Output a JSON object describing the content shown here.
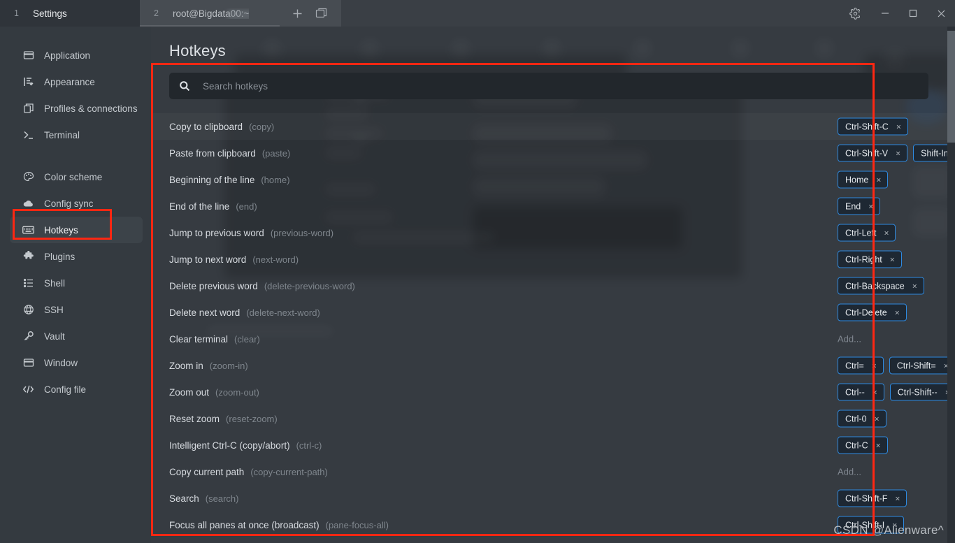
{
  "window": {
    "tabs": [
      {
        "index": "1",
        "label": "Settings",
        "active": false
      },
      {
        "index": "2",
        "label": "root@Bigdata00:~",
        "active": true
      }
    ],
    "new_tab_icon": "plus-icon",
    "split_icon": "split-pane-icon",
    "controls": {
      "settings": "gear-icon",
      "minimize": "minimize-icon",
      "maximize": "maximize-icon",
      "close": "close-icon"
    }
  },
  "sidebar": {
    "groups": [
      {
        "items": [
          {
            "label": "Application",
            "icon": "window-icon"
          },
          {
            "label": "Appearance",
            "icon": "paint-brush-icon"
          },
          {
            "label": "Profiles & connections",
            "icon": "copy-icon"
          },
          {
            "label": "Terminal",
            "icon": "terminal-prompt-icon"
          }
        ]
      },
      {
        "items": [
          {
            "label": "Color scheme",
            "icon": "palette-icon"
          },
          {
            "label": "Config sync",
            "icon": "cloud-icon"
          },
          {
            "label": "Hotkeys",
            "icon": "keyboard-icon",
            "active": true
          },
          {
            "label": "Plugins",
            "icon": "puzzle-piece-icon"
          },
          {
            "label": "Shell",
            "icon": "list-icon"
          },
          {
            "label": "SSH",
            "icon": "globe-icon"
          },
          {
            "label": "Vault",
            "icon": "key-icon"
          },
          {
            "label": "Window",
            "icon": "window-icon"
          },
          {
            "label": "Config file",
            "icon": "code-icon"
          }
        ]
      }
    ]
  },
  "main": {
    "title": "Hotkeys",
    "search": {
      "placeholder": "Search hotkeys",
      "value": "",
      "icon": "search-icon"
    },
    "add_label": "Add...",
    "rows": [
      {
        "label": "Copy to clipboard",
        "id": "(copy)",
        "hover": true,
        "chips": [
          "Ctrl-Shift-C"
        ]
      },
      {
        "label": "Paste from clipboard",
        "id": "(paste)",
        "chips": [
          "Ctrl-Shift-V",
          "Shift-Insert"
        ]
      },
      {
        "label": "Beginning of the line",
        "id": "(home)",
        "chips": [
          "Home"
        ]
      },
      {
        "label": "End of the line",
        "id": "(end)",
        "chips": [
          "End"
        ]
      },
      {
        "label": "Jump to previous word",
        "id": "(previous-word)",
        "chips": [
          "Ctrl-Left"
        ]
      },
      {
        "label": "Jump to next word",
        "id": "(next-word)",
        "chips": [
          "Ctrl-Right"
        ]
      },
      {
        "label": "Delete previous word",
        "id": "(delete-previous-word)",
        "chips": [
          "Ctrl-Backspace"
        ]
      },
      {
        "label": "Delete next word",
        "id": "(delete-next-word)",
        "chips": [
          "Ctrl-Delete"
        ]
      },
      {
        "label": "Clear terminal",
        "id": "(clear)",
        "chips": [],
        "add": true
      },
      {
        "label": "Zoom in",
        "id": "(zoom-in)",
        "chips": [
          "Ctrl=",
          "Ctrl-Shift="
        ]
      },
      {
        "label": "Zoom out",
        "id": "(zoom-out)",
        "chips": [
          "Ctrl--",
          "Ctrl-Shift--"
        ]
      },
      {
        "label": "Reset zoom",
        "id": "(reset-zoom)",
        "chips": [
          "Ctrl-0"
        ]
      },
      {
        "label": "Intelligent Ctrl-C (copy/abort)",
        "id": "(ctrl-c)",
        "chips": [
          "Ctrl-C"
        ]
      },
      {
        "label": "Copy current path",
        "id": "(copy-current-path)",
        "chips": [],
        "add": true
      },
      {
        "label": "Search",
        "id": "(search)",
        "chips": [
          "Ctrl-Shift-F"
        ]
      },
      {
        "label": "Focus all panes at once (broadcast)",
        "id": "(pane-focus-all)",
        "chips": [
          "Ctrl-Shift-I"
        ]
      }
    ]
  },
  "annotations": {
    "color": "#fe2712",
    "watermark": "CSDN @Alienware^"
  }
}
